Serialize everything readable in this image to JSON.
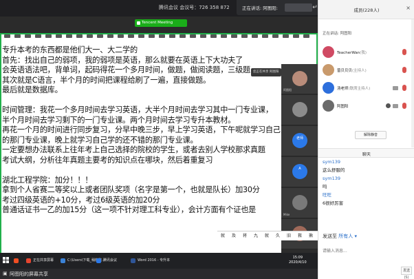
{
  "top_bar": {
    "title": "腾讯会议 会议号：726 358 872",
    "speaking_label": "正在讲话: 阿图阳:"
  },
  "shared_screen": {
    "app_badge": "Tencent Meeting",
    "float_toolbar": "您正在共享 阿图阳",
    "document_lines": [
      "专升本考的东西都是他们大一、大二学的",
      "首先：找出自己的弱项，我的弱项是英语，那么就要在英语上下大功夫了",
      "会英语语法吧，背单词，起码得花一个多月时间，做题，做阅读题，三级题",
      "其次就是C语言，半个月的时间把课程给刷了一遍，直接做题。",
      "最后就是数据库。",
      "",
      "时间管理：我花一个多月时间去学习英语，大半个月时间去学习其中一门专业课，",
      "半个月时间去学习剩下的一门专业课。两个月时间去学习专升本教材。",
      "再花一个月的时间进行同步复习，分早中晚三步，早上学习英语，下午呢就学习自己比较弱势",
      "的那门专业课，晚上就学习自己学的还不错的那门专业课。",
      "一定要想办法联系上往年考上自己选择的院校的学生，或者去别人学校那求真题",
      "考试大纲，分析往年真题主要考的知识点在哪块，然后着重复习",
      "",
      "湖北工程学院：加分！！！",
      "拿到个人省赛二等奖以上或者团队奖项（名字是第一个，也就是队长）加30分",
      "考过四级英语的+10分，考过6级英语的加20分",
      "普通话证书一乙的加15分（这一项不针对理工科专业），会计方面有个证也是"
    ],
    "video_tiles": [
      {
        "name": "阿图阳",
        "label": ""
      },
      {
        "name": "",
        "label": ""
      },
      {
        "name": "",
        "label": "老师"
      },
      {
        "name": "",
        "label": "A"
      },
      {
        "name": "Mike",
        "label": ""
      },
      {
        "name": "",
        "label": ""
      }
    ],
    "ime_candidates": [
      "就",
      "及",
      "将",
      "九",
      "就",
      "久",
      "旧",
      "救",
      "揪"
    ],
    "taskbar": {
      "items": [
        {
          "label": "",
          "color": "#f04e23"
        },
        {
          "label": "正在共享屏幕",
          "color": "#e6452f"
        },
        {
          "label": "C:\\Users\\下载_稍微整...",
          "color": "#3b82d6"
        },
        {
          "label": "腾讯会议",
          "color": "#2b79e9"
        },
        {
          "label": "Word 2016 - 专升本",
          "color": "#2f5597"
        }
      ],
      "clock_time": "15:09",
      "clock_date": "2020/4/10"
    }
  },
  "bottom_bar": {
    "sharing_text": "阿图阳的屏幕共享"
  },
  "panel": {
    "members_title": "成员(228人)",
    "speaking_row": "正在讲话: 阿图阳",
    "members": [
      {
        "name": "TeacherWan",
        "role": "(我)",
        "color": "#d04a63"
      },
      {
        "name": "曾贝贝贝",
        "role": "(主持人)",
        "color": "#c99a6c"
      },
      {
        "name": "汤老师",
        "role": "(联席主持人)",
        "color": "#2d6fdc"
      },
      {
        "name": "阿图阳",
        "role": "",
        "color": "#6b6b6b"
      }
    ],
    "unmute_all": "解除静音",
    "chat_title": "聊天",
    "chat": [
      {
        "sender": "sym139",
        "text": "这么舒服的"
      },
      {
        "sender": "sym139",
        "text": "吗"
      },
      {
        "sender": "旺旺",
        "text": "6很好厉害"
      }
    ],
    "send_to_label": "发送至",
    "send_to_target": "所有人",
    "input_placeholder": "请输入消息...",
    "send_button": "发送(S)"
  },
  "colors": {
    "accent_green": "#21b04b",
    "link_blue": "#2a6fc9",
    "mic_red": "#d9534f"
  }
}
